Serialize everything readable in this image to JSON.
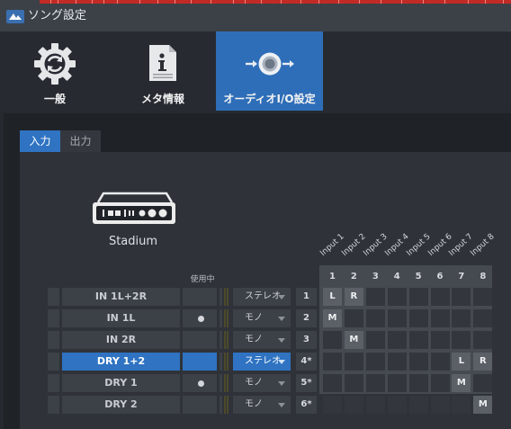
{
  "window": {
    "title": "ソング設定"
  },
  "top_tabs": [
    {
      "label": "一般",
      "icon": "refresh-gear-icon",
      "active": false
    },
    {
      "label": "メタ情報",
      "icon": "info-document-icon",
      "active": false
    },
    {
      "label": "オーディオI/O設定",
      "icon": "audio-io-icon",
      "active": true
    }
  ],
  "sub_tabs": [
    {
      "label": "入力",
      "active": true
    },
    {
      "label": "出力",
      "active": false
    }
  ],
  "device": {
    "name": "Stadium",
    "icon": "audio-interface-icon"
  },
  "in_use_header": "使用中",
  "input_columns": [
    "Input 1",
    "Input 2",
    "Input 3",
    "Input 4",
    "Input 5",
    "Input 6",
    "Input 7",
    "Input 8"
  ],
  "column_numbers": [
    "1",
    "2",
    "3",
    "4",
    "5",
    "6",
    "7",
    "8"
  ],
  "rows": [
    {
      "name": "IN 1L+2R",
      "in_use": false,
      "type": "ステレオ",
      "channel": "1",
      "selected": false,
      "assign": {
        "0": "L",
        "1": "R"
      }
    },
    {
      "name": "IN 1L",
      "in_use": true,
      "type": "モノ",
      "channel": "2",
      "selected": false,
      "assign": {
        "0": "M"
      }
    },
    {
      "name": "IN 2R",
      "in_use": false,
      "type": "モノ",
      "channel": "3",
      "selected": false,
      "assign": {
        "1": "M"
      }
    },
    {
      "name": "DRY 1+2",
      "in_use": false,
      "type": "ステレオ",
      "channel": "4*",
      "selected": true,
      "assign": {
        "6": "L",
        "7": "R"
      }
    },
    {
      "name": "DRY 1",
      "in_use": true,
      "type": "モノ",
      "channel": "5*",
      "selected": false,
      "assign": {
        "6": "M"
      }
    },
    {
      "name": "DRY 2",
      "in_use": false,
      "type": "モノ",
      "channel": "6*",
      "selected": false,
      "assign": {
        "7": "M"
      }
    }
  ]
}
